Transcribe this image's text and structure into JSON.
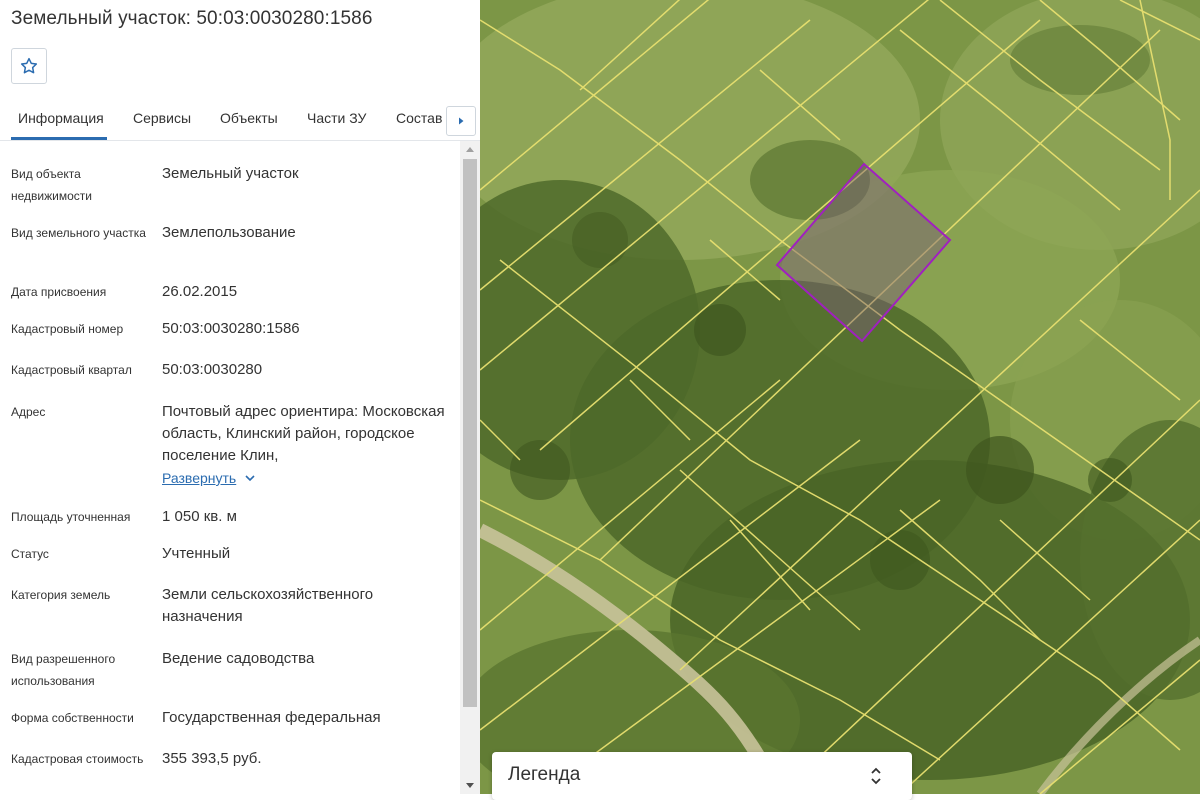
{
  "panel": {
    "title": "Земельный участок: 50:03:0030280:1586",
    "favorite_icon": "star-outline-icon",
    "tabs": [
      "Информация",
      "Сервисы",
      "Объекты",
      "Части ЗУ",
      "Состав"
    ],
    "active_tab": "Информация",
    "tab_next_icon": "caret-right-icon"
  },
  "details": [
    {
      "label": "Вид объекта недвижимости",
      "value": "Земельный участок"
    },
    {
      "label": "Вид земельного участка",
      "value": "Землепользование"
    },
    {
      "label": "Дата присвоения",
      "value": "26.02.2015"
    },
    {
      "label": "Кадастровый номер",
      "value": "50:03:0030280:1586"
    },
    {
      "label": "Кадастровый квартал",
      "value": "50:03:0030280"
    },
    {
      "label": "Адрес",
      "value": "Почтовый адрес ориентира: Московская область, Клинский район, городское поселение Клин,",
      "link": "Развернуть"
    },
    {
      "label": "Площадь уточненная",
      "value": "1 050 кв. м"
    },
    {
      "label": "Статус",
      "value": "Учтенный"
    },
    {
      "label": "Категория земель",
      "value": "Земли сельскохозяйственного назначения"
    },
    {
      "label": "Вид разрешенного использования",
      "value": "Ведение садоводства"
    },
    {
      "label": "Форма собственности",
      "value": "Государственная федеральная"
    },
    {
      "label": "Кадастровая стоимость",
      "value": "355 393,5 руб."
    }
  ],
  "legend": {
    "title": "Легенда",
    "toggle_icon": "chevron-up-down-icon"
  },
  "colors": {
    "accent": "#2b6cb0",
    "parcel_outline": "#a020c0",
    "boundary_lines": "#e8e070"
  }
}
